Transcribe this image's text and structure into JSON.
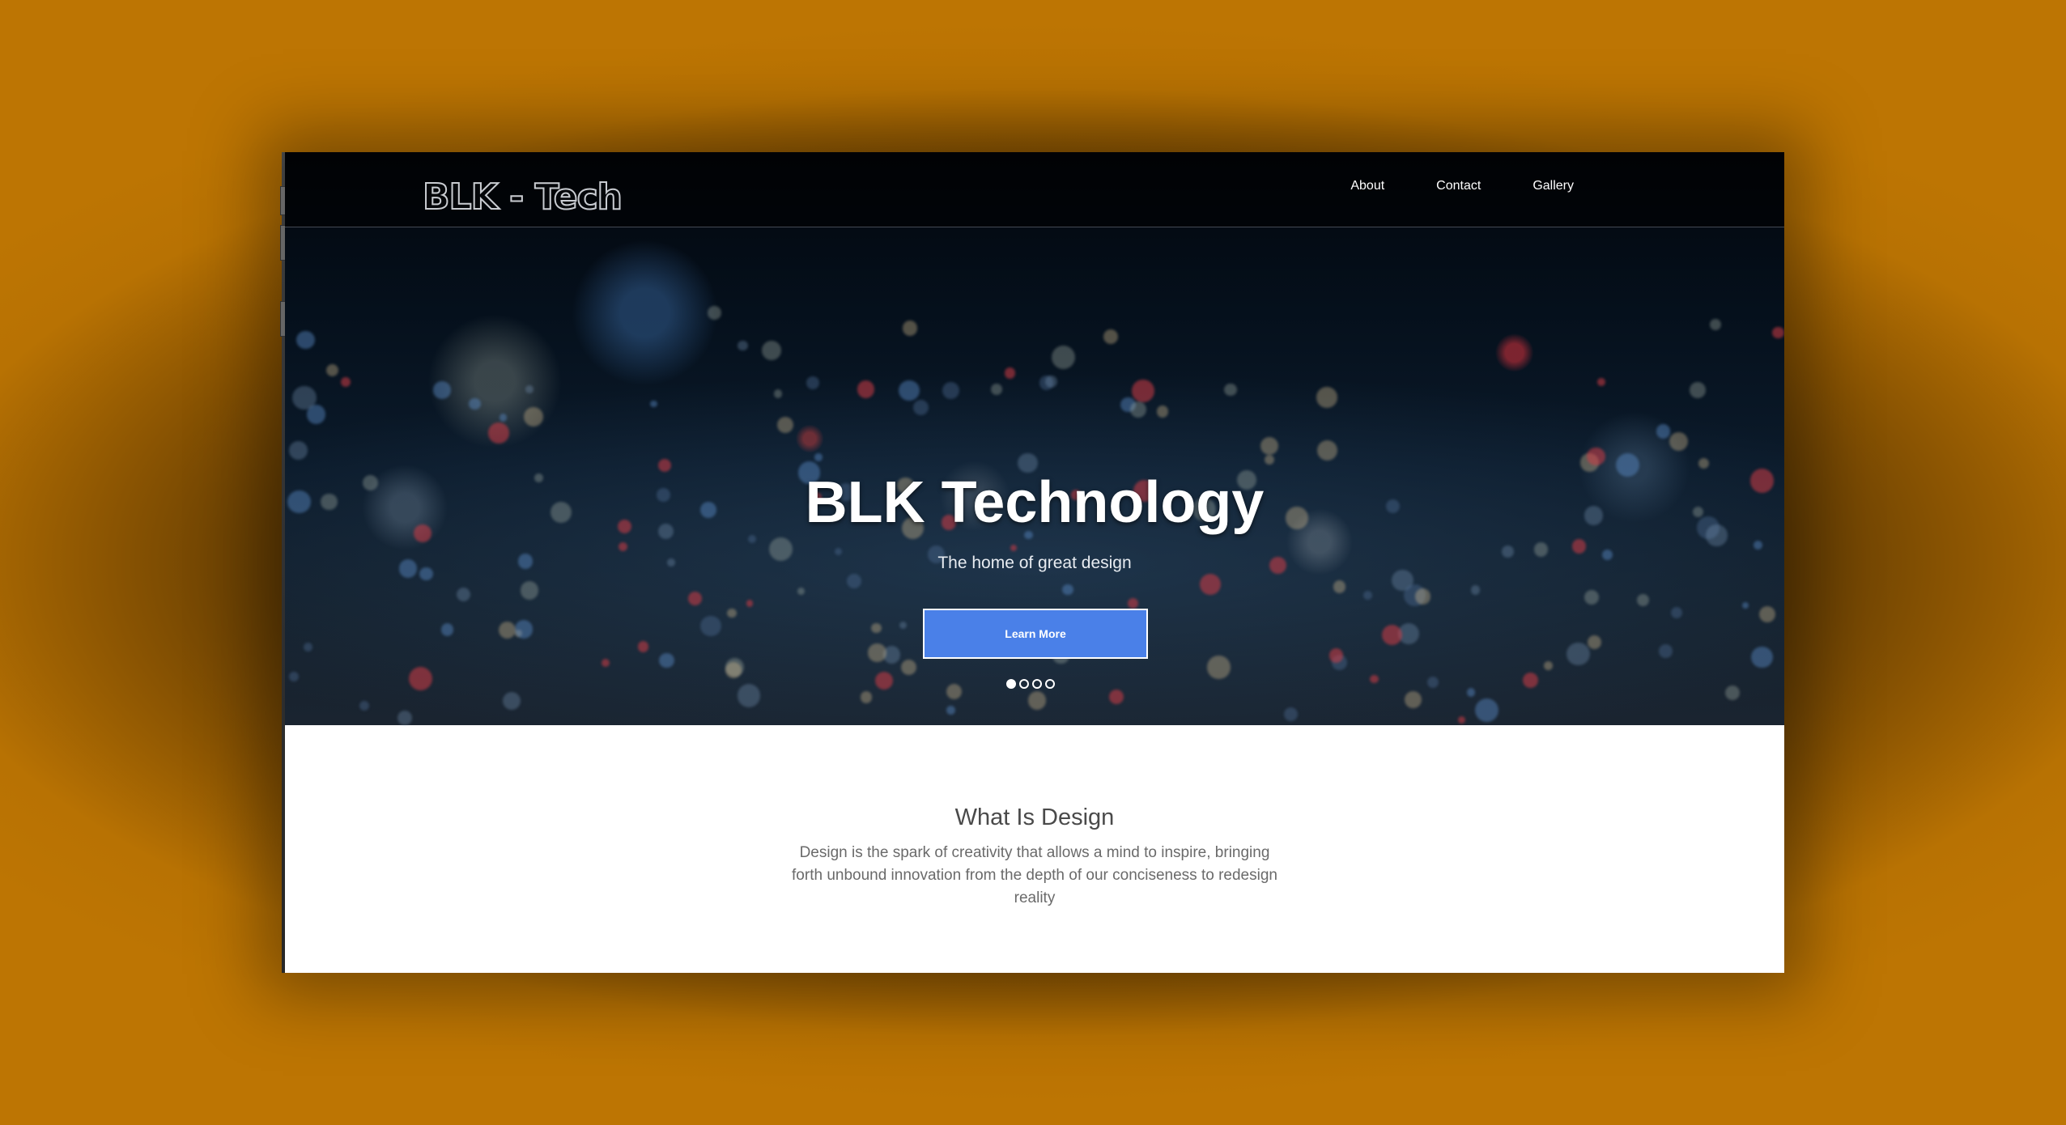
{
  "brand": {
    "logo_text": "BLK - Tech"
  },
  "nav": {
    "items": [
      {
        "label": "About"
      },
      {
        "label": "Contact"
      },
      {
        "label": "Gallery"
      }
    ]
  },
  "hero": {
    "title": "BLK Technology",
    "subtitle": "The home of great design",
    "cta_label": "Learn More",
    "carousel": {
      "slide_count": 4,
      "active_index": 0
    }
  },
  "about_section": {
    "title": "What Is Design",
    "body": "Design is the spark of creativity that allows a mind to inspire, bringing forth unbound innovation from the depth of our conciseness to redesign reality"
  },
  "colors": {
    "backdrop": "#b87203",
    "cta": "#4a80e8",
    "hero_dark": "#05101c"
  }
}
